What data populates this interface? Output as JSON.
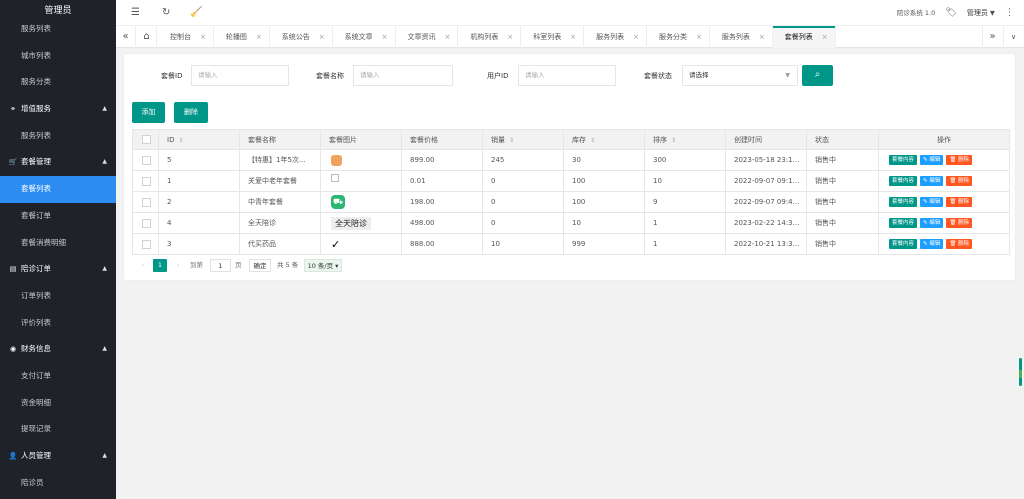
{
  "sidebar": {
    "title": "管理员",
    "items": [
      {
        "type": "item",
        "label": "服务列表"
      },
      {
        "type": "item",
        "label": "城市列表"
      },
      {
        "type": "item",
        "label": "服务分类"
      },
      {
        "type": "group",
        "label": "增值服务",
        "icon": "link-icon"
      },
      {
        "type": "item",
        "label": "服务列表"
      },
      {
        "type": "group",
        "label": "套餐管理",
        "icon": "cart-icon"
      },
      {
        "type": "item",
        "label": "套餐列表",
        "active": true
      },
      {
        "type": "item",
        "label": "套餐订单"
      },
      {
        "type": "item",
        "label": "套餐消费明细"
      },
      {
        "type": "group",
        "label": "陪诊订单",
        "icon": "file-icon"
      },
      {
        "type": "item",
        "label": "订单列表"
      },
      {
        "type": "item",
        "label": "评价列表"
      },
      {
        "type": "group",
        "label": "财务信息",
        "icon": "finance-icon"
      },
      {
        "type": "item",
        "label": "支付订单"
      },
      {
        "type": "item",
        "label": "资金明细"
      },
      {
        "type": "item",
        "label": "提现记录"
      },
      {
        "type": "group",
        "label": "人员管理",
        "icon": "user-icon"
      },
      {
        "type": "item",
        "label": "陪诊员"
      }
    ]
  },
  "topbar": {
    "system_label": "陪诊系统 1.0",
    "user": "管理员"
  },
  "tabs": [
    {
      "label": "控制台"
    },
    {
      "label": "轮播图"
    },
    {
      "label": "系统公告"
    },
    {
      "label": "系统文章"
    },
    {
      "label": "文章资讯"
    },
    {
      "label": "机构列表"
    },
    {
      "label": "科室列表"
    },
    {
      "label": "服务列表"
    },
    {
      "label": "服务分类"
    },
    {
      "label": "服务列表"
    },
    {
      "label": "套餐列表",
      "active": true
    }
  ],
  "filters": {
    "id_label": "套餐ID",
    "id_placeholder": "请输入",
    "name_label": "套餐名称",
    "name_placeholder": "请输入",
    "user_label": "用户ID",
    "user_placeholder": "请输入",
    "status_label": "套餐状态",
    "status_value": "请选择"
  },
  "actions": {
    "add": "添加",
    "delete": "删除"
  },
  "table": {
    "headers": [
      "ID",
      "套餐名称",
      "套餐图片",
      "套餐价格",
      "销量",
      "库存",
      "排序",
      "创建时间",
      "状态",
      "操作"
    ],
    "rows": [
      {
        "id": "5",
        "name": "【特惠】1年5次...",
        "img": "orange",
        "price": "899.00",
        "sales": "245",
        "stock": "30",
        "sort": "300",
        "created": "2023-05-18 23:1...",
        "status": "销售中"
      },
      {
        "id": "1",
        "name": "关爱中老年套餐",
        "img": "broken",
        "price": "0.01",
        "sales": "0",
        "stock": "100",
        "sort": "10",
        "created": "2022-09-07 09:1...",
        "status": "销售中"
      },
      {
        "id": "2",
        "name": "中青年套餐",
        "img": "green",
        "price": "198.00",
        "sales": "0",
        "stock": "100",
        "sort": "9",
        "created": "2022-09-07 09:4...",
        "status": "销售中"
      },
      {
        "id": "4",
        "name": "全天陪诊",
        "img": "text",
        "img_text": "全天陪诊",
        "price": "498.00",
        "sales": "0",
        "stock": "10",
        "sort": "1",
        "created": "2023-02-22 14:3...",
        "status": "销售中"
      },
      {
        "id": "3",
        "name": "代买药品",
        "img": "swoosh",
        "price": "888.00",
        "sales": "10",
        "stock": "999",
        "sort": "1",
        "created": "2022-10-21 13:3...",
        "status": "销售中"
      }
    ],
    "ops": {
      "content": "套餐内容",
      "edit": "编辑",
      "delete": "删除"
    }
  },
  "pager": {
    "current": "1",
    "goto_label": "到第",
    "goto_value": "1",
    "page_unit": "页",
    "confirm": "确定",
    "total": "共 5 条",
    "per_page": "10 条/页"
  },
  "colors": {
    "accent": "#009688",
    "sidebar_bg": "#20222a",
    "active_item": "#2d8cf0",
    "status": "#1e9f4b",
    "delete": "#ff5722",
    "edit": "#1e9fff"
  }
}
